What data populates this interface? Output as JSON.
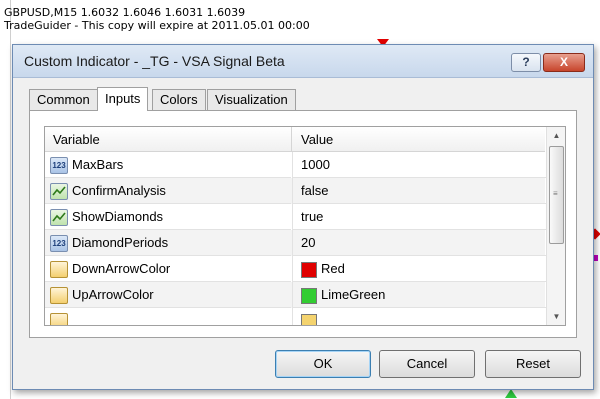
{
  "chart": {
    "symbol_line": "GBPUSD,M15  1.6032 1.6046 1.6031 1.6039",
    "expiry_line": "TradeGuider - This copy will expire at 2011.05.01 00:00"
  },
  "dialog": {
    "title": "Custom Indicator - _TG - VSA Signal Beta",
    "help_label": "?",
    "close_label": "X",
    "tabs": [
      {
        "label": "Common"
      },
      {
        "label": "Inputs"
      },
      {
        "label": "Colors"
      },
      {
        "label": "Visualization"
      }
    ],
    "active_tab": "Inputs",
    "grid": {
      "col_variable": "Variable",
      "col_value": "Value",
      "rows": [
        {
          "icon": "number-type-icon",
          "icon_text": "123",
          "variable": "MaxBars",
          "value": "1000"
        },
        {
          "icon": "bool-type-icon",
          "icon_text": "",
          "variable": "ConfirmAnalysis",
          "value": "false"
        },
        {
          "icon": "bool-type-icon",
          "icon_text": "",
          "variable": "ShowDiamonds",
          "value": "true"
        },
        {
          "icon": "number-type-icon",
          "icon_text": "123",
          "variable": "DiamondPeriods",
          "value": "20"
        },
        {
          "icon": "color-type-icon",
          "icon_text": "",
          "variable": "DownArrowColor",
          "value": "Red",
          "swatch": "#e00000"
        },
        {
          "icon": "color-type-icon",
          "icon_text": "",
          "variable": "UpArrowColor",
          "value": "LimeGreen",
          "swatch": "#32cd32"
        }
      ]
    },
    "buttons": {
      "ok": "OK",
      "cancel": "Cancel",
      "reset": "Reset"
    }
  },
  "colors": {
    "title_bar": "#c8d8ec",
    "close_button": "#c7452c",
    "down_arrow": "#e00000",
    "up_arrow": "#2ecc40"
  }
}
